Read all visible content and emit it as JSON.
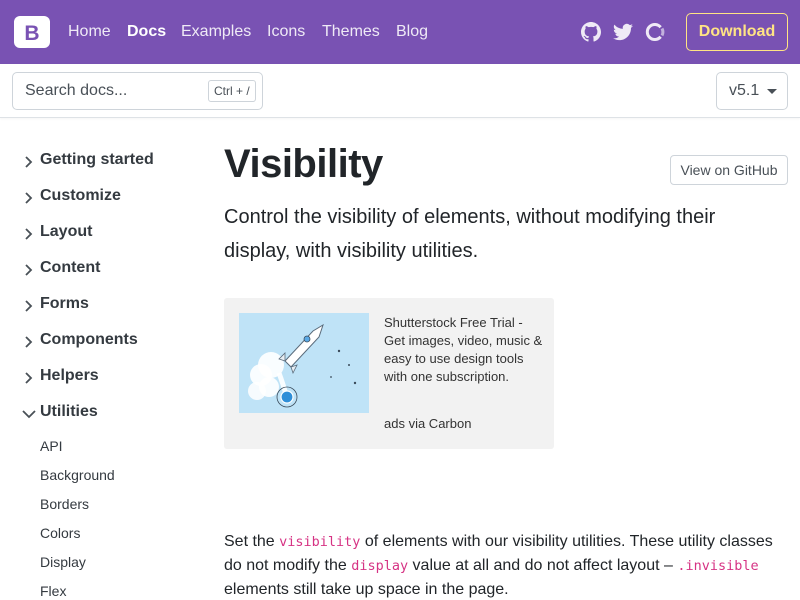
{
  "navbar": {
    "brand_letter": "B",
    "links": [
      {
        "label": "Home",
        "active": false
      },
      {
        "label": "Docs",
        "active": true
      },
      {
        "label": "Examples",
        "active": false
      },
      {
        "label": "Icons",
        "active": false
      },
      {
        "label": "Themes",
        "active": false
      },
      {
        "label": "Blog",
        "active": false
      }
    ],
    "social_icons": [
      "github-icon",
      "twitter-icon",
      "opencollective-icon"
    ],
    "download_label": "Download",
    "bg_color": "#7952b3",
    "download_color": "#ffe484"
  },
  "subnav": {
    "search_placeholder": "Search docs...",
    "search_shortcut": "Ctrl + /",
    "version": "v5.1"
  },
  "sidebar": {
    "items": [
      {
        "label": "Getting started",
        "expanded": false
      },
      {
        "label": "Customize",
        "expanded": false
      },
      {
        "label": "Layout",
        "expanded": false
      },
      {
        "label": "Content",
        "expanded": false
      },
      {
        "label": "Forms",
        "expanded": false
      },
      {
        "label": "Components",
        "expanded": false
      },
      {
        "label": "Helpers",
        "expanded": false
      },
      {
        "label": "Utilities",
        "expanded": true
      }
    ],
    "utilities_children": [
      "API",
      "Background",
      "Borders",
      "Colors",
      "Display",
      "Flex"
    ]
  },
  "main": {
    "title": "Visibility",
    "github_button": "View on GitHub",
    "lead": "Control the visibility of elements, without modifying their display, with visibility utilities.",
    "ad": {
      "text": "Shutterstock Free Trial - Get images, video, music & easy to use design tools with one subscription.",
      "powered_by": "ads via Carbon"
    },
    "body": {
      "part1": "Set the ",
      "code1": "visibility",
      "part2": " of elements with our visibility utilities. These utility classes do not modify the ",
      "code2": "display",
      "part3": " value at all and do not affect layout – ",
      "code3": ".invisible",
      "part4": " elements still take up space in the page."
    }
  }
}
